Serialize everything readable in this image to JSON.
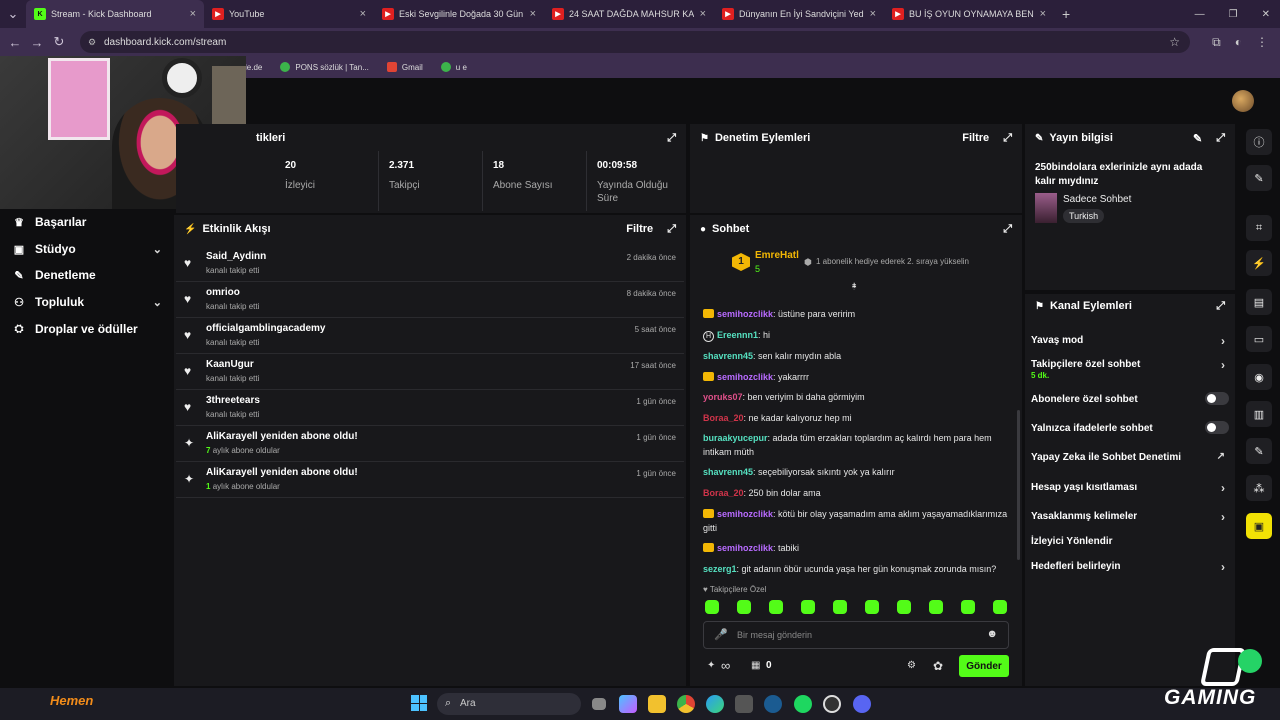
{
  "browser": {
    "tabs": [
      {
        "title": "Stream - Kick Dashboard",
        "active": true
      },
      {
        "title": "YouTube"
      },
      {
        "title": "Eski Sevgilinle Doğada 30 Gün"
      },
      {
        "title": "24 SAAT DAĞDA MAHSUR KAL"
      },
      {
        "title": "Dünyanın En İyi Sandviçini Yed"
      },
      {
        "title": "BU İŞ OYUN OYNAMAYA BENZ"
      }
    ],
    "new_tab": "+",
    "url": "dashboard.kick.com/stream",
    "bookmarks": [
      "le.de",
      "PONS sözlük | Tan...",
      "Gmail",
      "u e"
    ]
  },
  "nav": {
    "items": [
      {
        "label": "Başarılar",
        "icon": "trophy-icon"
      },
      {
        "label": "Stüdyo",
        "icon": "studio-icon",
        "chevron": true
      },
      {
        "label": "Denetleme",
        "icon": "wrench-icon"
      },
      {
        "label": "Topluluk",
        "icon": "community-icon",
        "chevron": true
      },
      {
        "label": "Droplar ve ödüller",
        "icon": "drops-icon"
      }
    ]
  },
  "stats": {
    "title": "tikleri",
    "items": [
      {
        "value": "20",
        "label": "İzleyici"
      },
      {
        "value": "2.371",
        "label": "Takipçi"
      },
      {
        "value": "18",
        "label": "Abone Sayısı"
      },
      {
        "value": "00:09:58",
        "label": "Yayında Olduğu Süre"
      }
    ]
  },
  "moderation": {
    "title": "Denetim Eylemleri",
    "filter": "Filtre"
  },
  "stream_info": {
    "title": "Yayın bilgisi",
    "stream_title": "250bindolara exlerinizle aynı adada kalır mıydınız",
    "category": "Sadece Sohbet",
    "language": "Turkish"
  },
  "activity": {
    "title": "Etkinlik Akışı",
    "filter": "Filtre",
    "items": [
      {
        "name": "Said_Aydinn",
        "sub": "kanalı takip etti",
        "time": "2 dakika önce",
        "icon": "heart-icon"
      },
      {
        "name": "omrioo",
        "sub": "kanalı takip etti",
        "time": "8 dakika önce",
        "icon": "heart-icon"
      },
      {
        "name": "officialgamblingacademy",
        "sub": "kanalı takip etti",
        "time": "5 saat önce",
        "icon": "heart-icon"
      },
      {
        "name": "KaanUgur",
        "sub": "kanalı takip etti",
        "time": "17 saat önce",
        "icon": "heart-icon"
      },
      {
        "name": "3threetears",
        "sub": "kanalı takip etti",
        "time": "1 gün önce",
        "icon": "heart-icon"
      },
      {
        "name": "AliKarayell yeniden abone oldu!",
        "sub_num": "7",
        "sub": "aylık abone oldular",
        "time": "1 gün önce",
        "icon": "sparkle-icon"
      },
      {
        "name": "AliKarayell yeniden abone oldu!",
        "sub_num": "1",
        "sub": "aylık abone oldular",
        "time": "1 gün önce",
        "icon": "sparkle-icon"
      }
    ]
  },
  "chat": {
    "title": "Sohbet",
    "pinned": {
      "rank": "1",
      "user": "EmreHatl",
      "count": "5",
      "message": "1 abonelik hediye ederek 2. sıraya yükselin"
    },
    "messages": [
      {
        "user": "semihozclikk",
        "color": "#b86bff",
        "badge": "crown",
        "text": "üstüne para veririm"
      },
      {
        "user": "Ereennn1",
        "color": "#55e0c0",
        "badge": "mod",
        "text": "hi"
      },
      {
        "user": "shavrenn45",
        "color": "#55e0c0",
        "text": "sen kalır mıydın abla"
      },
      {
        "user": "semihozclikk",
        "color": "#b86bff",
        "badge": "crown",
        "text": "yakarrrr"
      },
      {
        "user": "yoruks07",
        "color": "#e0508a",
        "text": "ben veriyim bi daha görmiyim"
      },
      {
        "user": "Boraa_20",
        "color": "#d0344a",
        "text": "ne kadar kalıyoruz hep mi"
      },
      {
        "user": "buraakyucepur",
        "color": "#55e0c0",
        "text": "adada tüm erzakları toplardım aç kalırdı hem para hem intikam müth"
      },
      {
        "user": "shavrenn45",
        "color": "#55e0c0",
        "text": "seçebiliyorsak sıkıntı yok ya kalırır"
      },
      {
        "user": "Boraa_20",
        "color": "#d0344a",
        "text": "250 bin dolar ama"
      },
      {
        "user": "semihozclikk",
        "color": "#b86bff",
        "badge": "crown",
        "text": "kötü bir olay yaşamadım ama aklım yaşayamadıklarımıza gitti"
      },
      {
        "user": "semihozclikk",
        "color": "#b86bff",
        "badge": "crown",
        "text": "tabiki"
      },
      {
        "user": "sezerg1",
        "color": "#55e0c0",
        "text": "git adanın öbür ucunda yaşa her gün konuşmak zorunda mısın?"
      }
    ],
    "followers_only": "Takipçilere Özel",
    "input_placeholder": "Bir mesaj gönderin",
    "infinity": "∞",
    "count": "0",
    "send": "Gönder"
  },
  "channel_actions": {
    "title": "Kanal Eylemleri",
    "items": [
      {
        "label": "Yavaş mod",
        "type": "chevron"
      },
      {
        "label": "Takipçilere özel sohbet",
        "sub": "5 dk.",
        "type": "chevron"
      },
      {
        "label": "Abonelere özel sohbet",
        "type": "toggle"
      },
      {
        "label": "Yalnızca ifadelerle sohbet",
        "type": "toggle"
      },
      {
        "label": "Yapay Zeka ile Sohbet Denetimi",
        "type": "external"
      },
      {
        "label": "Hesap yaşı kısıtlaması",
        "type": "chevron"
      },
      {
        "label": "Yasaklanmış kelimeler",
        "type": "chevron"
      },
      {
        "label": "İzleyici Yönlendir",
        "type": "none"
      },
      {
        "label": "Hedefleri belirleyin",
        "type": "chevron"
      }
    ]
  },
  "taskbar": {
    "search": "Ara"
  },
  "overlay": {
    "hemen": "Hemen",
    "gaming": "GAMING"
  },
  "colors": {
    "accent": "#53fc18",
    "panel": "#18181b",
    "bg": "#0e0e10"
  }
}
